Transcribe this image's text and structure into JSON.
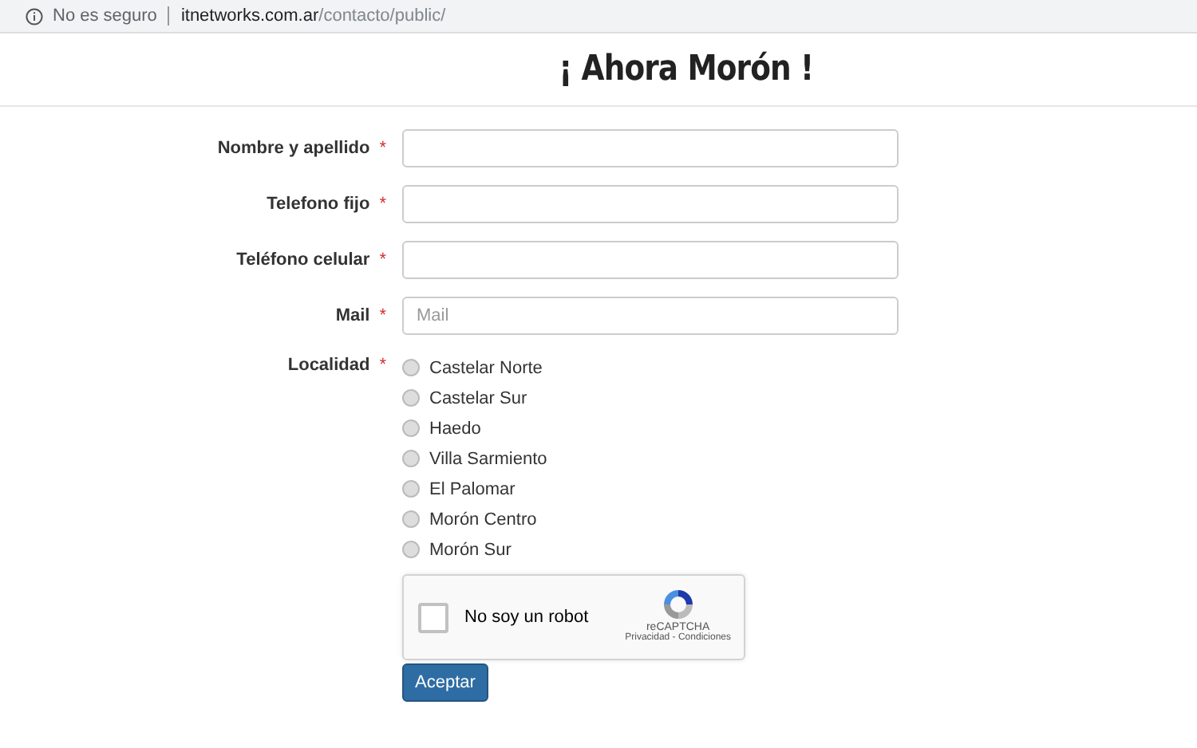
{
  "address_bar": {
    "security": "No es seguro",
    "domain": "itnetworks.com.ar",
    "path": "/contacto/public/"
  },
  "title": "¡ Ahora Morón !",
  "fields": [
    {
      "label": "Nombre y apellido",
      "required": "*"
    },
    {
      "label": "Telefono fijo",
      "required": "*"
    },
    {
      "label": "Teléfono celular",
      "required": "*"
    },
    {
      "label": "Mail",
      "required": "*",
      "placeholder": "Mail"
    }
  ],
  "localidad": {
    "label": "Localidad",
    "required": "*",
    "options": [
      {
        "label": "Castelar Norte",
        "selected": false
      },
      {
        "label": "Castelar Sur",
        "selected": false
      },
      {
        "label": "Haedo",
        "selected": false
      },
      {
        "label": "Villa Sarmiento",
        "selected": false
      },
      {
        "label": "El Palomar",
        "selected": false
      },
      {
        "label": "Morón Centro",
        "selected": false
      },
      {
        "label": "Morón Sur",
        "selected": false
      }
    ]
  },
  "captcha": {
    "label": "No soy un robot",
    "checked": false,
    "brand": "reCAPTCHA",
    "links": "Privacidad - Condiciones"
  },
  "submit": "Aceptar"
}
